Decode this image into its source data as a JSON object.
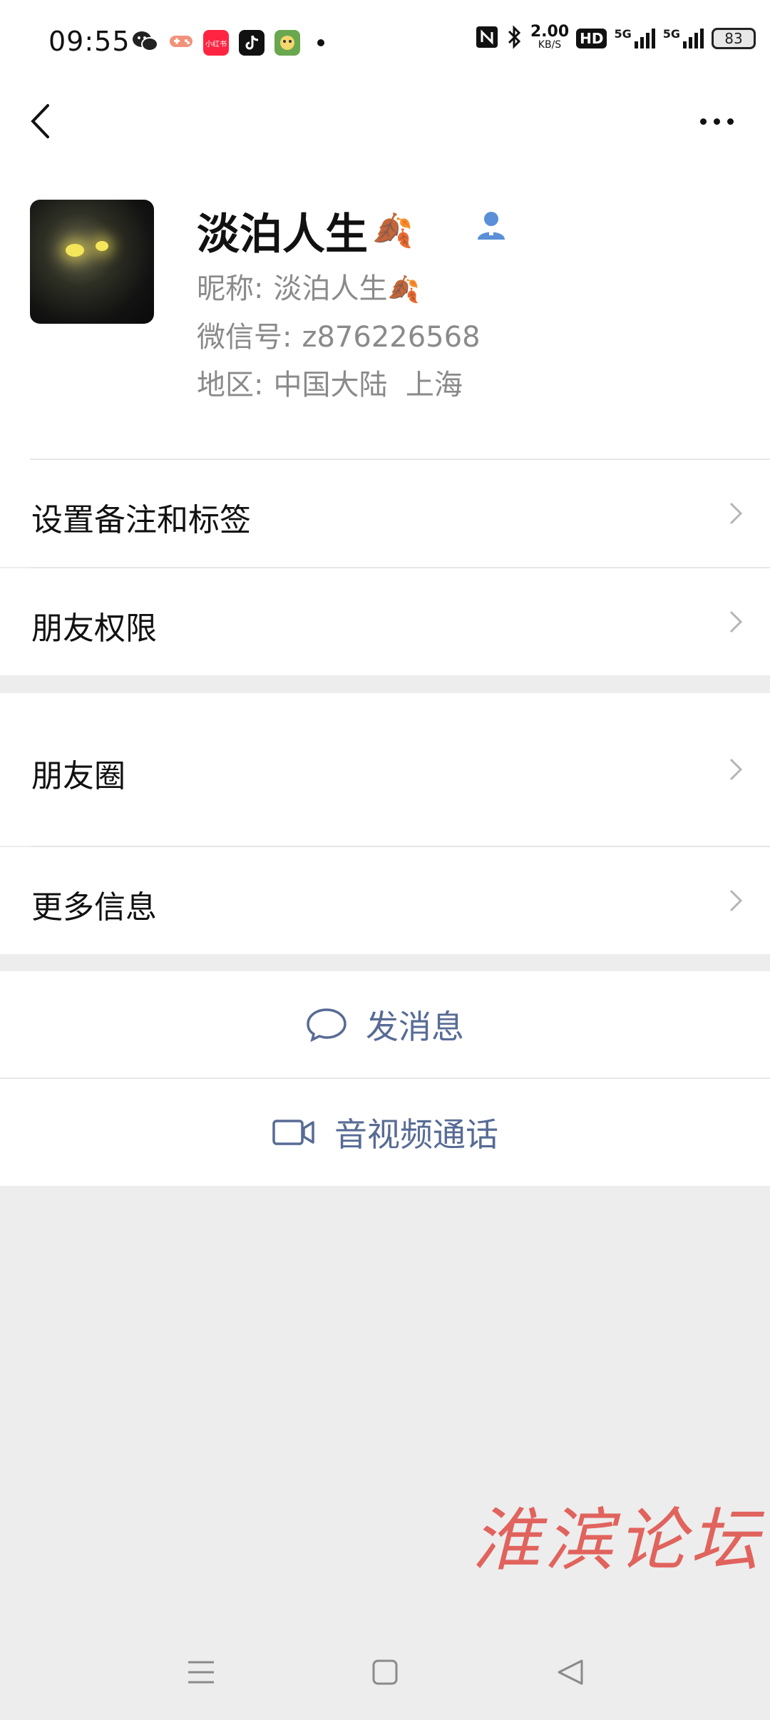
{
  "status_bar": {
    "time": "09:55",
    "net_speed_value": "2.00",
    "net_speed_unit": "KB/S",
    "hd_label": "HD",
    "signal_label_1": "5G",
    "signal_label_2": "5G",
    "battery": "83",
    "app_icons": [
      "wechat-icon",
      "game-icon",
      "xiaohongshu-icon",
      "tiktok-icon",
      "game-app-icon",
      "more-dot-icon"
    ],
    "xiaohongshu_text": "小红书"
  },
  "topbar": {
    "back_icon": "chevron-left-icon",
    "more_icon": "more-dots-icon"
  },
  "profile": {
    "name": "淡泊人生",
    "name_emoji": "🍂",
    "nickname_label": "昵称:",
    "nickname_value": "淡泊人生",
    "nickname_emoji": "🍂",
    "wechat_id_label": "微信号:",
    "wechat_id_value": "z876226568",
    "region_label": "地区:",
    "region_value": "中国大陆  上海",
    "contact_icon_color": "#5b8fd8"
  },
  "menu": {
    "remarks_tags": "设置备注和标签",
    "friend_permissions": "朋友权限",
    "moments": "朋友圈",
    "more_info": "更多信息"
  },
  "actions": {
    "send_message": "发消息",
    "video_call": "音视频通话",
    "accent_color": "#576b95"
  },
  "watermark": "淮滨论坛",
  "navbar": {
    "icons": [
      "menu-icon",
      "home-square-icon",
      "back-triangle-icon"
    ]
  }
}
